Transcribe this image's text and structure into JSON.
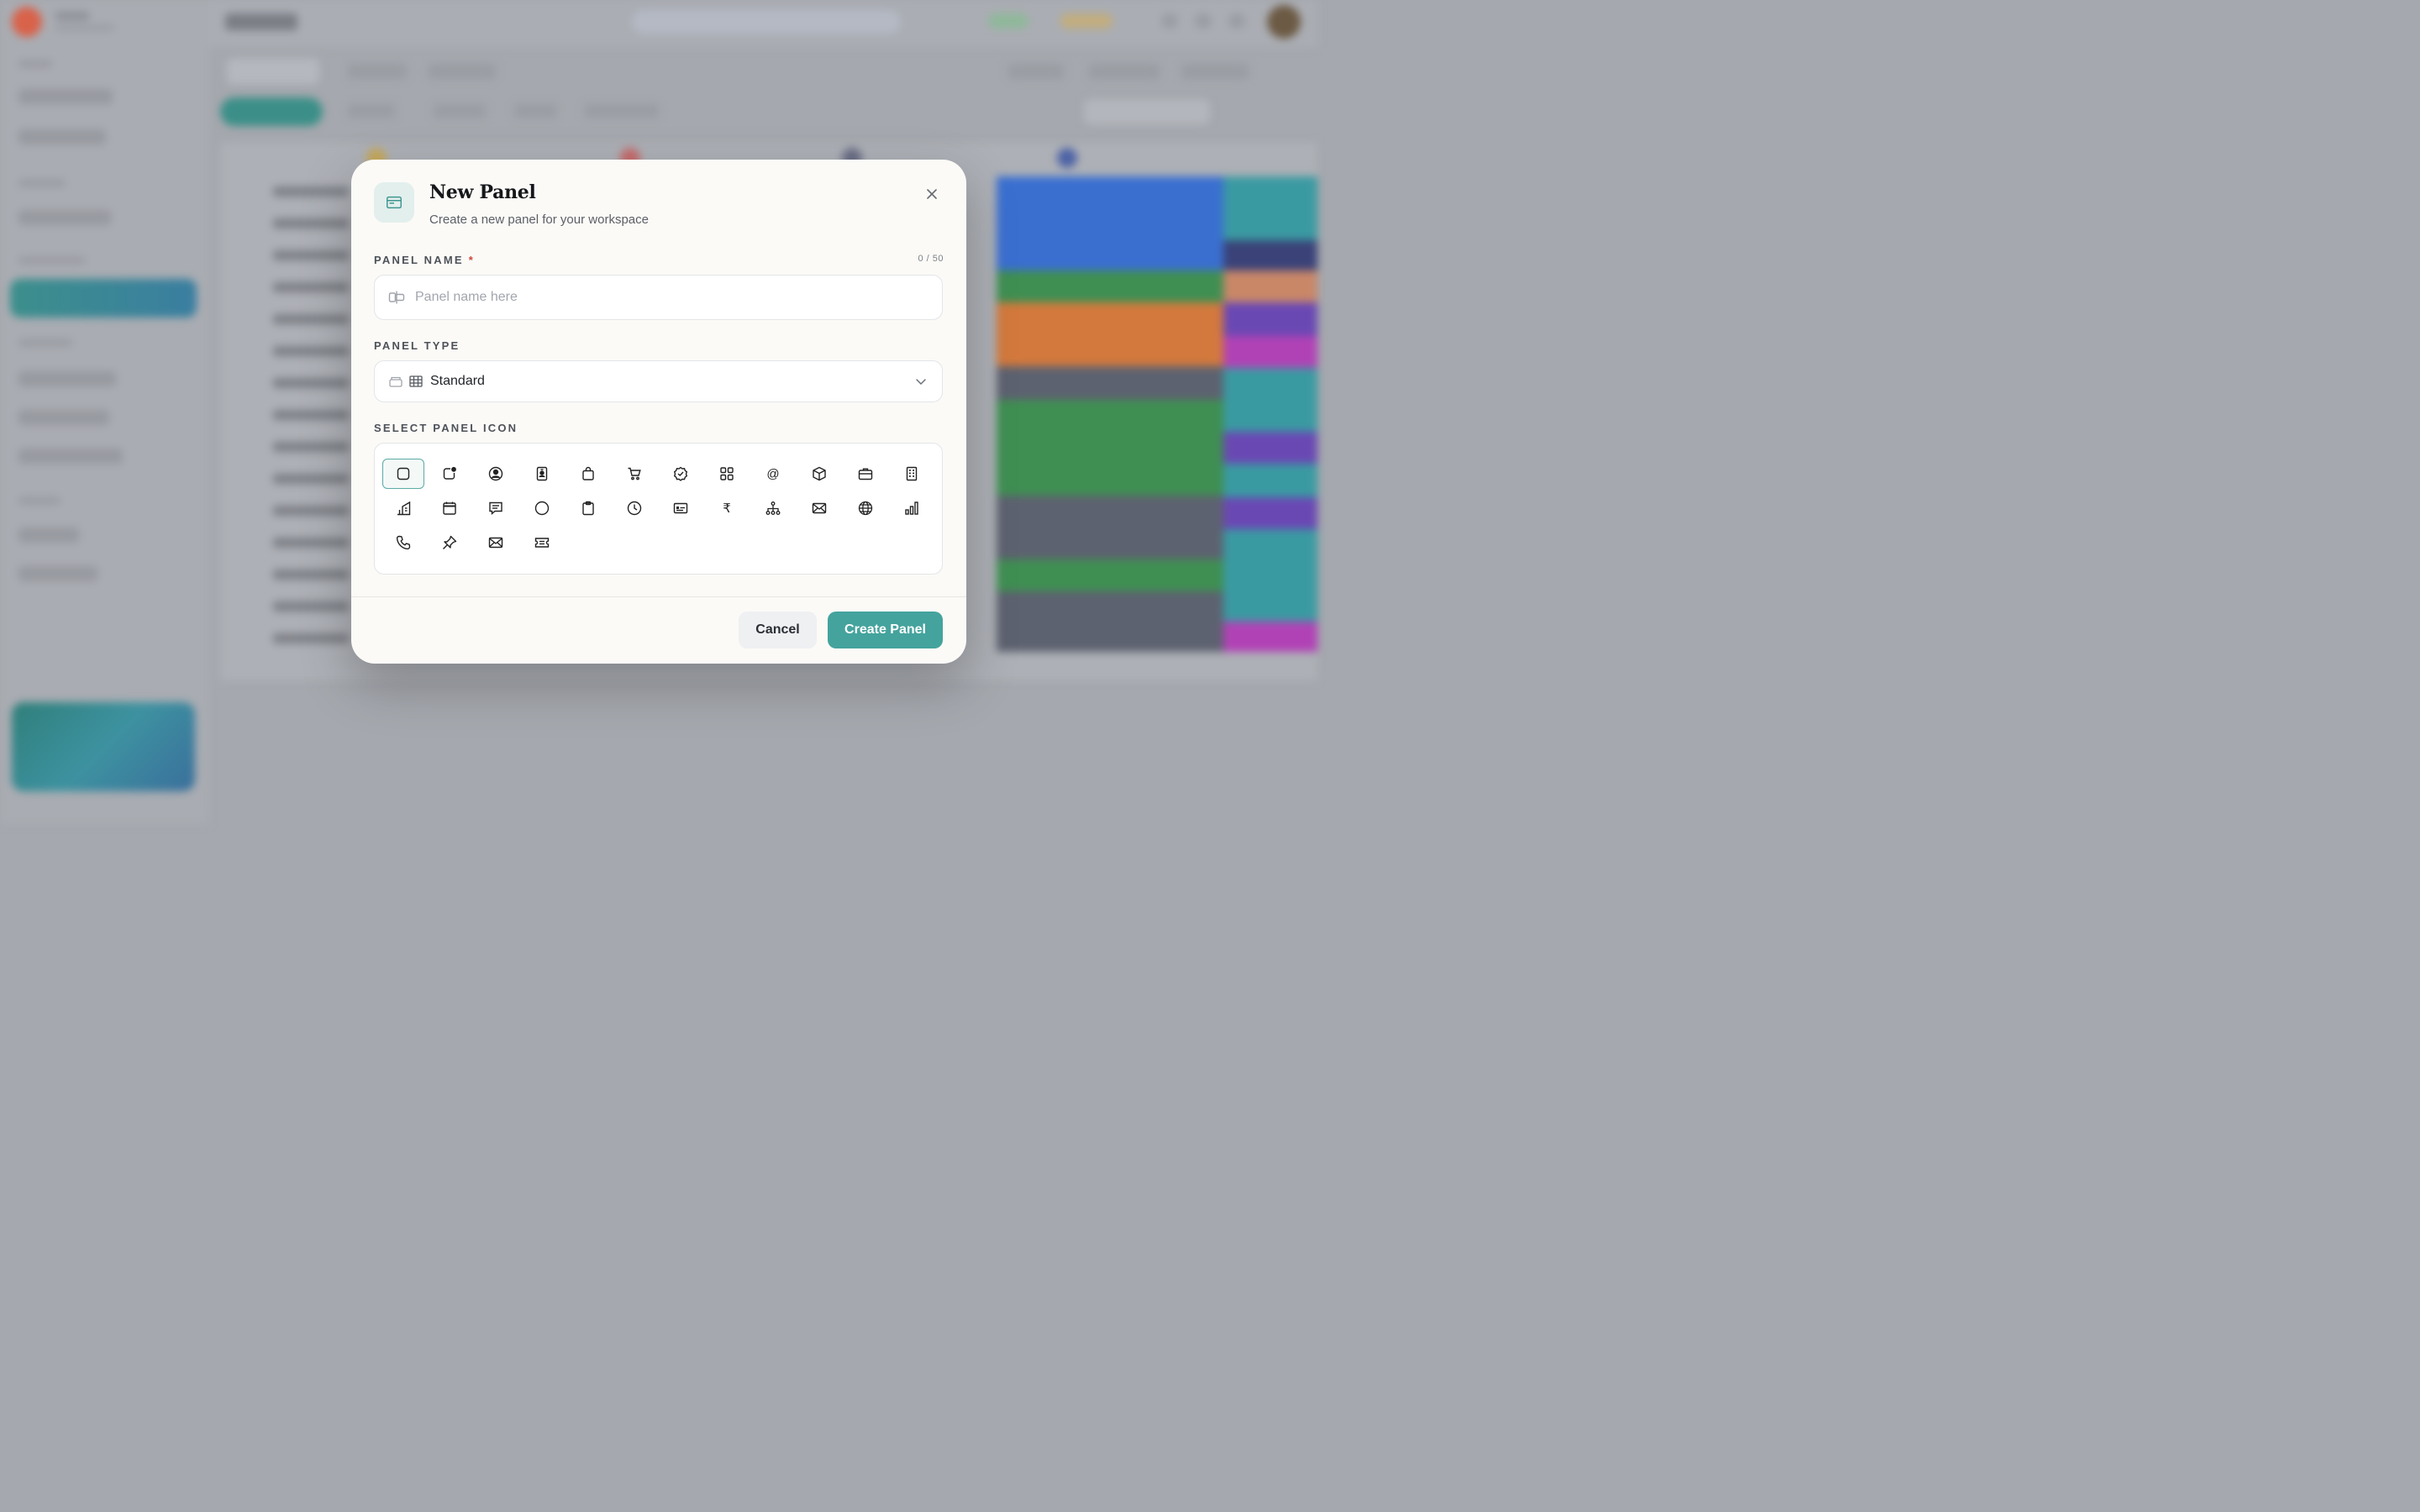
{
  "modal": {
    "title": "New Panel",
    "subtitle": "Create a new panel for your workspace",
    "header_icon": "panel-icon",
    "close_icon": "close-icon",
    "name_field": {
      "label": "PANEL NAME",
      "required_mark": "*",
      "counter": "0 / 50",
      "placeholder": "Panel name here",
      "value": "",
      "icon": "label-tag-icon"
    },
    "type_field": {
      "label": "PANEL TYPE",
      "value": "Standard",
      "icons": [
        "tray-icon",
        "table-icon"
      ],
      "chevron": "chevron-down-icon"
    },
    "icon_picker": {
      "label": "SELECT PANEL ICON",
      "selected_index": 0,
      "icons": [
        "square-icon",
        "notification-square-icon",
        "user-circle-icon",
        "id-badge-icon",
        "shopping-bag-icon",
        "cart-icon",
        "badge-check-icon",
        "grid-icon",
        "at-sign-icon",
        "package-icon",
        "briefcase-icon",
        "building-icon",
        "building-chart-icon",
        "calendar-icon",
        "message-icon",
        "circle-icon",
        "clipboard-icon",
        "clock-icon",
        "id-card-icon",
        "rupee-icon",
        "hierarchy-icon",
        "mail-icon",
        "globe-icon",
        "bar-chart-icon",
        "phone-icon",
        "pin-icon",
        "envelope-icon",
        "ticket-icon"
      ],
      "rupee_glyph": "₹",
      "at_glyph": "@"
    },
    "cancel_label": "Cancel",
    "create_label": "Create Panel",
    "accent_color": "#44a39d"
  }
}
